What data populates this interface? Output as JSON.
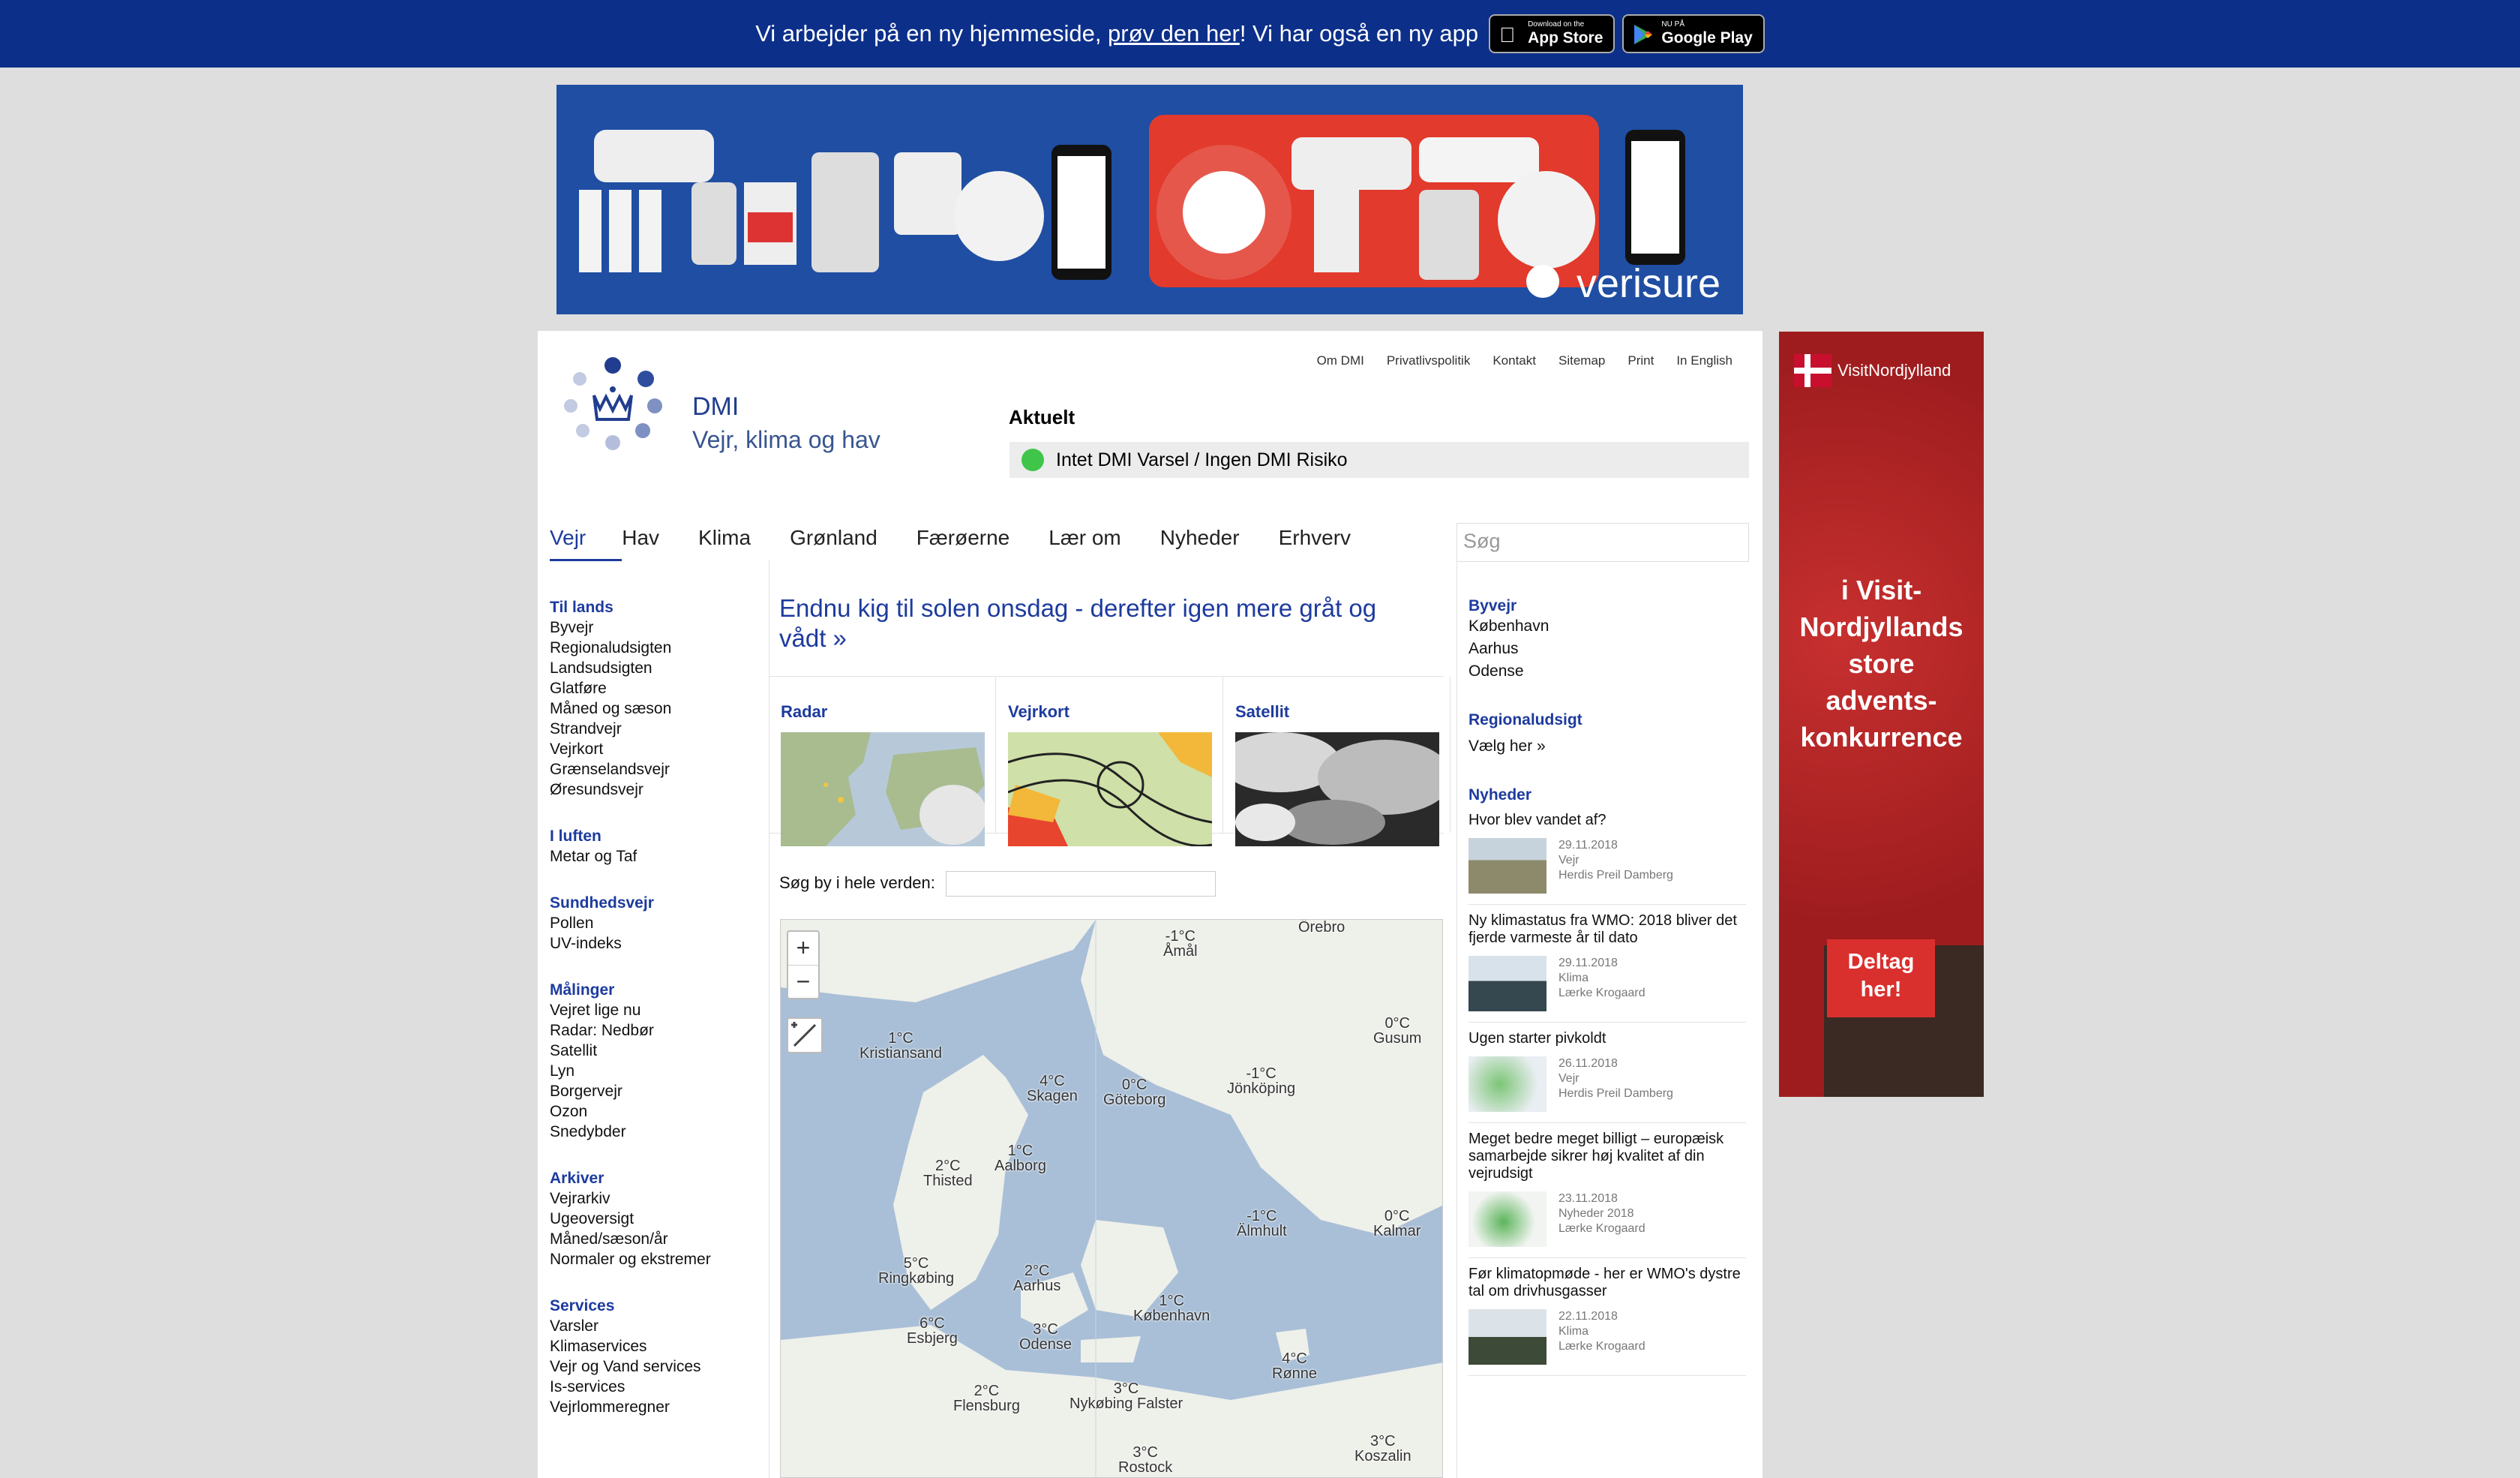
{
  "banner": {
    "text_before": "Vi arbejder på en ny hjemmeside, ",
    "link": "prøv den her",
    "text_after": "! Vi har også en ny app",
    "appstore_small": "Download on the",
    "appstore_big": "App Store",
    "googleplay_small": "NU PÅ",
    "googleplay_big": "Google Play"
  },
  "ads": {
    "top_brand": "verisure",
    "side_brand": "VisitNordjylland",
    "side_text": "i Visit-Nordjyllands store advents-konkurrence",
    "side_cta": "Deltag her!"
  },
  "header": {
    "toplinks": [
      "Om DMI",
      "Privatlivspolitik",
      "Kontakt",
      "Sitemap",
      "Print",
      "In English"
    ],
    "logo_title": "DMI",
    "logo_subtitle": "Vejr, klima og hav",
    "aktuelt": "Aktuelt",
    "varsel": "Intet DMI Varsel / Ingen DMI Risiko"
  },
  "nav": [
    "Vejr",
    "Hav",
    "Klima",
    "Grønland",
    "Færøerne",
    "Lær om",
    "Nyheder",
    "Erhverv"
  ],
  "search_placeholder": "Søg",
  "leftnav": [
    {
      "head": "Til lands",
      "items": [
        "Byvejr",
        "Regionaludsigten",
        "Landsudsigten",
        "Glatføre",
        "Måned og sæson",
        "Strandvejr",
        "Vejrkort",
        "Grænselandsvejr",
        "Øresundsvejr"
      ]
    },
    {
      "head": "I luften",
      "items": [
        "Metar og Taf"
      ]
    },
    {
      "head": "Sundhedsvejr",
      "items": [
        "Pollen",
        "UV-indeks"
      ]
    },
    {
      "head": "Målinger",
      "items": [
        "Vejret lige nu",
        "Radar: Nedbør",
        "Satellit",
        "Lyn",
        "Borgervejr",
        "Ozon",
        "Snedybder"
      ]
    },
    {
      "head": "Arkiver",
      "items": [
        "Vejrarkiv",
        "Ugeoversigt",
        "Måned/sæson/år",
        "Normaler og ekstremer"
      ]
    },
    {
      "head": "Services",
      "items": [
        "Varsler",
        "Klimaservices",
        "Vejr og Vand services",
        "Is-services",
        "Vejrlommeregner"
      ]
    }
  ],
  "headline": "Endnu kig til solen onsdag - derefter igen mere gråt og vådt »",
  "thumbs": [
    "Radar",
    "Vejrkort",
    "Satellit"
  ],
  "city_search_label": "Søg by i hele verden:",
  "map": {
    "zoom_in": "+",
    "zoom_out": "−",
    "labels": [
      {
        "temp": "-1°C",
        "city": "Åmål"
      },
      {
        "temp": "",
        "city": "Örebro"
      },
      {
        "temp": "1°C",
        "city": "Kristiansand"
      },
      {
        "temp": "0°C",
        "city": "Gusum"
      },
      {
        "temp": "4°C",
        "city": "Skagen"
      },
      {
        "temp": "0°C",
        "city": "Göteborg"
      },
      {
        "temp": "-1°C",
        "city": "Jönköping"
      },
      {
        "temp": "1°C",
        "city": "Aalborg"
      },
      {
        "temp": "2°C",
        "city": "Thisted"
      },
      {
        "temp": "-1°C",
        "city": "Älmhult"
      },
      {
        "temp": "0°C",
        "city": "Kalmar"
      },
      {
        "temp": "5°C",
        "city": "Ringkøbing"
      },
      {
        "temp": "2°C",
        "city": "Aarhus"
      },
      {
        "temp": "1°C",
        "city": "København"
      },
      {
        "temp": "6°C",
        "city": "Esbjerg"
      },
      {
        "temp": "3°C",
        "city": "Odense"
      },
      {
        "temp": "4°C",
        "city": "Rønne"
      },
      {
        "temp": "2°C",
        "city": "Flensburg"
      },
      {
        "temp": "3°C",
        "city": "Nykøbing Falster"
      },
      {
        "temp": "3°C",
        "city": "Rostock"
      },
      {
        "temp": "3°C",
        "city": "Koszalin"
      }
    ]
  },
  "right": {
    "byvejr_head": "Byvejr",
    "byvejr": [
      "København",
      "Aarhus",
      "Odense"
    ],
    "region_head": "Regionaludsigt",
    "region_link": "Vælg her »",
    "news_head": "Nyheder",
    "news": [
      {
        "title": "Hvor blev vandet af?",
        "date": "29.11.2018",
        "cat": "Vejr",
        "author": "Herdis Preil Damberg"
      },
      {
        "title": "Ny klimastatus fra WMO: 2018 bliver det fjerde varmeste år til dato",
        "date": "29.11.2018",
        "cat": "Klima",
        "author": "Lærke Krogaard"
      },
      {
        "title": "Ugen starter pivkoldt",
        "date": "26.11.2018",
        "cat": "Vejr",
        "author": "Herdis Preil Damberg"
      },
      {
        "title": "Meget bedre meget billigt – europæisk samarbejde sikrer høj kvalitet af din vejrudsigt",
        "date": "23.11.2018",
        "cat": "Nyheder 2018",
        "author": "Lærke Krogaard"
      },
      {
        "title": "Før klimatopmøde - her er WMO's dystre tal om drivhusgasser",
        "date": "22.11.2018",
        "cat": "Klima",
        "author": "Lærke Krogaard"
      }
    ]
  }
}
